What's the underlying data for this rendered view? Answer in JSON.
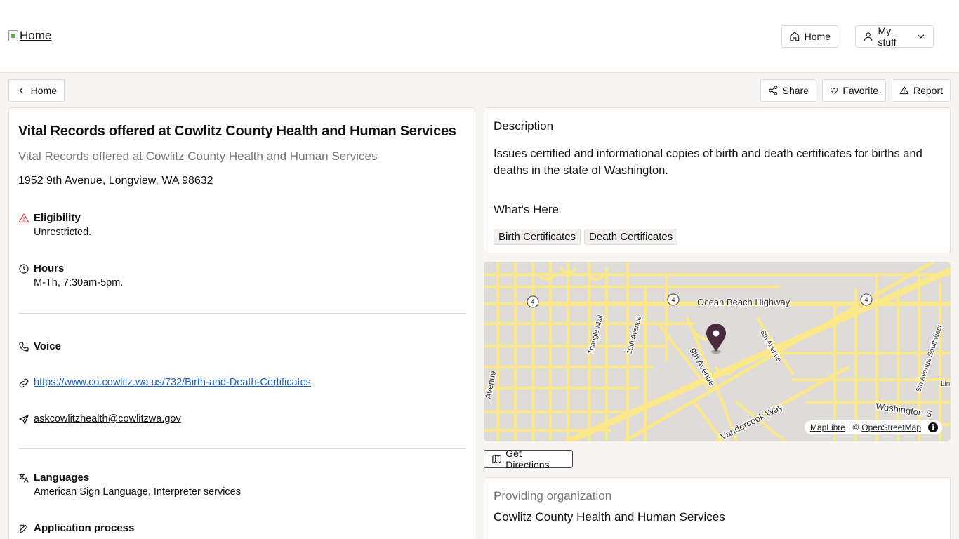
{
  "header": {
    "logo_alt": "Home",
    "home_label": "Home",
    "mystuff_label": "My stuff"
  },
  "toolbar": {
    "back_label": "Home",
    "share_label": "Share",
    "favorite_label": "Favorite",
    "report_label": "Report"
  },
  "service": {
    "title": "Vital Records offered at Cowlitz County Health and Human Services",
    "subtitle": "Vital Records offered at Cowlitz County Health and Human Services",
    "address": "1952 9th Avenue, Longview, WA 98632",
    "eligibility_label": "Eligibility",
    "eligibility_value": "Unrestricted.",
    "hours_label": "Hours",
    "hours_value": "M-Th, 7:30am-5pm.",
    "voice_label": "Voice",
    "website": "https://www.co.cowlitz.wa.us/732/Birth-and-Death-Certificates",
    "email": "askcowlitzhealth@cowlitzwa.gov",
    "languages_label": "Languages",
    "languages_value": "American Sign Language, Interpreter services",
    "application_label": "Application process"
  },
  "description": {
    "heading": "Description",
    "text": "Issues certified and informational copies of birth and death certificates for births and deaths in the state of Washington.",
    "whats_here_heading": "What's Here",
    "tags": [
      "Birth Certificates",
      "Death Certificates"
    ]
  },
  "map": {
    "labels": {
      "ocean_beach": "Ocean Beach Highway",
      "triangle_mall": "Triangle Mall",
      "tenth_ave": "10th Avenue",
      "ninth_ave": "9th Avenue",
      "eighth_ave": "8th Avenue",
      "vandercook": "Vandercook Way",
      "fifth_ave": "5th Avenue Southwest",
      "washington": "Washington S",
      "left_ave": "Avenue",
      "lin": "Lin",
      "route": "4"
    },
    "attribution_maplibre": "MapLibre",
    "attribution_sep": "| ©",
    "attribution_osm": "OpenStreetMap",
    "directions_label": "Get Directions",
    "road_color": "#fbe88a",
    "pin_color": "#4a2a3f"
  },
  "organization": {
    "heading": "Providing organization",
    "name": "Cowlitz County Health and Human Services"
  }
}
